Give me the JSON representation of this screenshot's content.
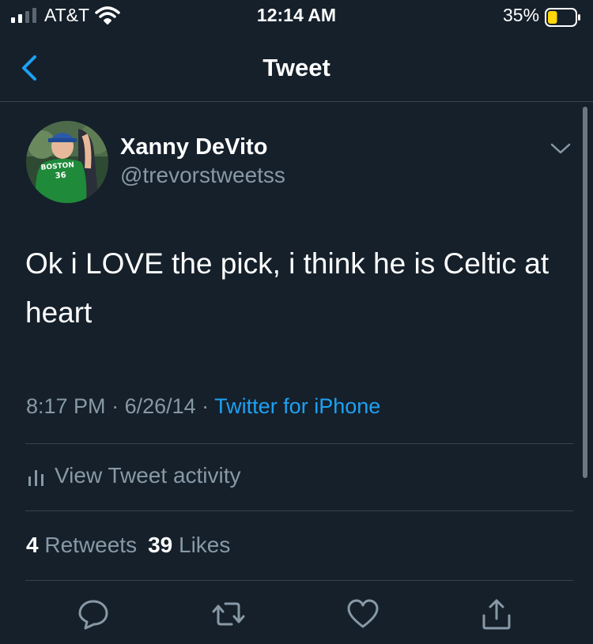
{
  "status_bar": {
    "carrier": "AT&T",
    "time": "12:14 AM",
    "battery_percent": "35%",
    "battery_level": 0.35
  },
  "nav": {
    "title": "Tweet",
    "back_icon": "chevron-left-icon"
  },
  "author": {
    "display_name": "Xanny DeVito",
    "handle": "@trevorstweetss",
    "shirt_text_line1": "BOSTON",
    "shirt_text_line2": "36"
  },
  "tweet": {
    "text": "Ok i LOVE the pick, i think he is Celtic at heart",
    "time": "8:17 PM",
    "date": "6/26/14",
    "source": "Twitter for iPhone"
  },
  "activity": {
    "label": "View Tweet activity"
  },
  "stats": {
    "retweets_count": "4",
    "retweets_label": "Retweets",
    "likes_count": "39",
    "likes_label": "Likes"
  },
  "actions": [
    "reply-icon",
    "retweet-icon",
    "like-icon",
    "share-icon"
  ],
  "colors": {
    "background": "#15202b",
    "secondary_text": "#8899a6",
    "link": "#1da1f2",
    "divider": "#38444d",
    "battery_fill": "#ffd60a"
  }
}
